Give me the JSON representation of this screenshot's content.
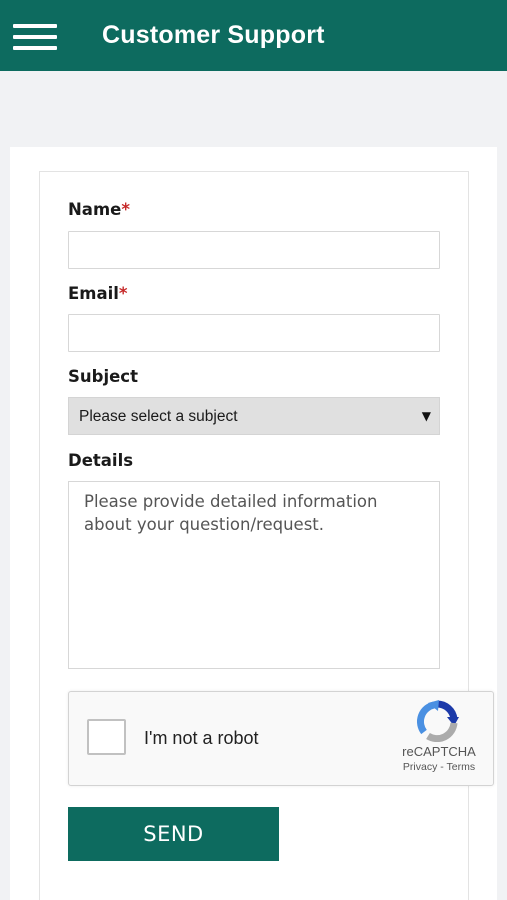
{
  "header": {
    "title": "Customer Support",
    "menu_icon": "hamburger-menu-icon",
    "background_color": "#0d6b5f"
  },
  "form": {
    "name_label": "Name",
    "email_label": "Email",
    "required_marker": "*",
    "subject_label": "Subject",
    "subject_selected": "Please select a subject",
    "subject_arrow": "▼",
    "details_label": "Details",
    "details_placeholder": "Please provide detailed information about your question/request."
  },
  "captcha": {
    "label": "I'm not a robot",
    "brand": "reCAPTCHA",
    "privacy_link": "Privacy",
    "separator": "-",
    "terms_link": "Terms"
  },
  "actions": {
    "send_label": "SEND",
    "button_color": "#0d6b5f"
  }
}
